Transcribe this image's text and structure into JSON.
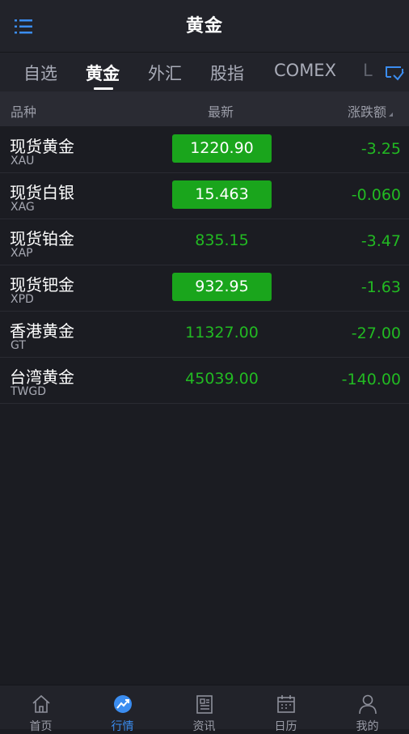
{
  "header": {
    "title": "黄金"
  },
  "tabs": [
    {
      "label": "自选",
      "active": false
    },
    {
      "label": "黄金",
      "active": true
    },
    {
      "label": "外汇",
      "active": false
    },
    {
      "label": "股指",
      "active": false
    },
    {
      "label": "COMEX",
      "active": false
    },
    {
      "label": "L",
      "active": false
    }
  ],
  "columns": {
    "name": "品种",
    "latest": "最新",
    "change": "涨跌额"
  },
  "rows": [
    {
      "name": "现货黄金",
      "code": "XAU",
      "price": "1220.90",
      "change": "-3.25",
      "highlight": true
    },
    {
      "name": "现货白银",
      "code": "XAG",
      "price": "15.463",
      "change": "-0.060",
      "highlight": true
    },
    {
      "name": "现货铂金",
      "code": "XAP",
      "price": "835.15",
      "change": "-3.47",
      "highlight": false
    },
    {
      "name": "现货钯金",
      "code": "XPD",
      "price": "932.95",
      "change": "-1.63",
      "highlight": true
    },
    {
      "name": "香港黄金",
      "code": "GT",
      "price": "11327.00",
      "change": "-27.00",
      "highlight": false
    },
    {
      "name": "台湾黄金",
      "code": "TWGD",
      "price": "45039.00",
      "change": "-140.00",
      "highlight": false
    }
  ],
  "bottom_nav": [
    {
      "label": "首页",
      "icon": "home-icon",
      "active": false
    },
    {
      "label": "行情",
      "icon": "market-chart-icon",
      "active": true
    },
    {
      "label": "资讯",
      "icon": "news-icon",
      "active": false
    },
    {
      "label": "日历",
      "icon": "calendar-icon",
      "active": false
    },
    {
      "label": "我的",
      "icon": "profile-icon",
      "active": false
    }
  ],
  "colors": {
    "background": "#1b1c22",
    "accent_blue": "#3b8df0",
    "price_green": "#22ba22",
    "highlight_green": "#1aa51c"
  }
}
